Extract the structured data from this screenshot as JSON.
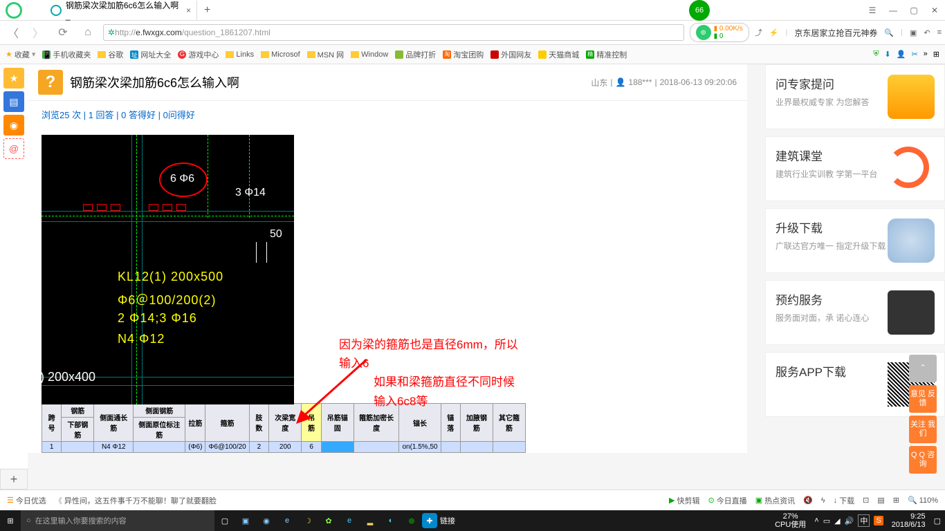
{
  "titlebar": {
    "tab_title": "钢筋梁次梁加筋6c6怎么输入啊_",
    "score": "66"
  },
  "addressbar": {
    "url_proto": "http://",
    "url_domain": "e.fwxgx.com",
    "url_path": "/question_1861207.html",
    "speed": "0.00K/s",
    "speed2": "0",
    "promo": "京东居家立抢百元神券"
  },
  "bookmarks": {
    "fav": "收藏",
    "items": [
      "手机收藏夹",
      "谷歌",
      "网址大全",
      "游戏中心",
      "Links",
      "Microsof",
      "MSN 网",
      "Window",
      "品牌打折",
      "淘宝团购",
      "外国网友",
      "天猫商城",
      "精准控制"
    ]
  },
  "question": {
    "icon": "?",
    "title": "钢筋梁次梁加筋6c6怎么输入啊",
    "region": "山东",
    "user": "188***",
    "datetime": "2018-06-13 09:20:06",
    "stats_views": "浏览25 次",
    "stats_answers": "1 回答",
    "stats_good": "0 答得好",
    "stats_ask": "0问得好"
  },
  "cad": {
    "label1": "6 Φ6",
    "label2": "3 Φ14",
    "label3": "50",
    "beam1": "KL12(1)  200x500",
    "beam2": "Φ6＠100/200(2)",
    "beam3": "2 Φ14;3 Φ16",
    "beam4": "N4 Φ12",
    "beam5": ") 200x400"
  },
  "annotation": {
    "line1": "因为梁的箍筋也是直径6mm，所以输入6",
    "line2": "如果和梁箍筋直径不同时候输入6c8等"
  },
  "rebar_table": {
    "headers": [
      "跨号",
      "钢筋",
      "侧面通长筋",
      "侧面钢筋",
      "拉筋",
      "箍筋",
      "肢数",
      "次梁宽度",
      "",
      "吊筋",
      "吊筋锚固",
      "箍筋加密长度",
      "锚长",
      "锚落",
      "加腋钢筋",
      "其它箍筋"
    ],
    "sub1": "下部钢筋",
    "sub2": "侧面原位标注筋",
    "row": [
      "1",
      "",
      "N4 Φ12",
      "",
      "(Φ6)",
      "Φ6@100/20",
      "2",
      "200",
      "6",
      "",
      "",
      "on(1.5%,50",
      "",
      "",
      "",
      ""
    ]
  },
  "cards": [
    {
      "title": "问专家提问",
      "sub": "业界最权威专家\n为您解答"
    },
    {
      "title": "建筑课堂",
      "sub": "建筑行业实训教\n学第一平台"
    },
    {
      "title": "升级下载",
      "sub": "广联达官方唯一\n指定升级下载"
    },
    {
      "title": "预约服务",
      "sub": "服务面对面，承\n诺心连心"
    },
    {
      "title": "服务APP下载",
      "sub": ""
    }
  ],
  "float": {
    "feedback": "意见\n反馈",
    "follow": "关注\n我们",
    "qq": "Q Q\n咨询"
  },
  "statusbar": {
    "today": "今日优选",
    "news": "异性间，这五件事千万不能聊！聊了就要翻脸",
    "r1": "快剪辑",
    "r2": "今日直播",
    "r3": "热点资讯",
    "r4": "下载",
    "zoom": "110%"
  },
  "taskbar": {
    "search_placeholder": "在这里输入你要搜索的内容",
    "link": "链接",
    "cpu_pct": "27%",
    "cpu_lbl": "CPU使用",
    "ime": "中",
    "time": "9:25",
    "date": "2018/6/13"
  }
}
